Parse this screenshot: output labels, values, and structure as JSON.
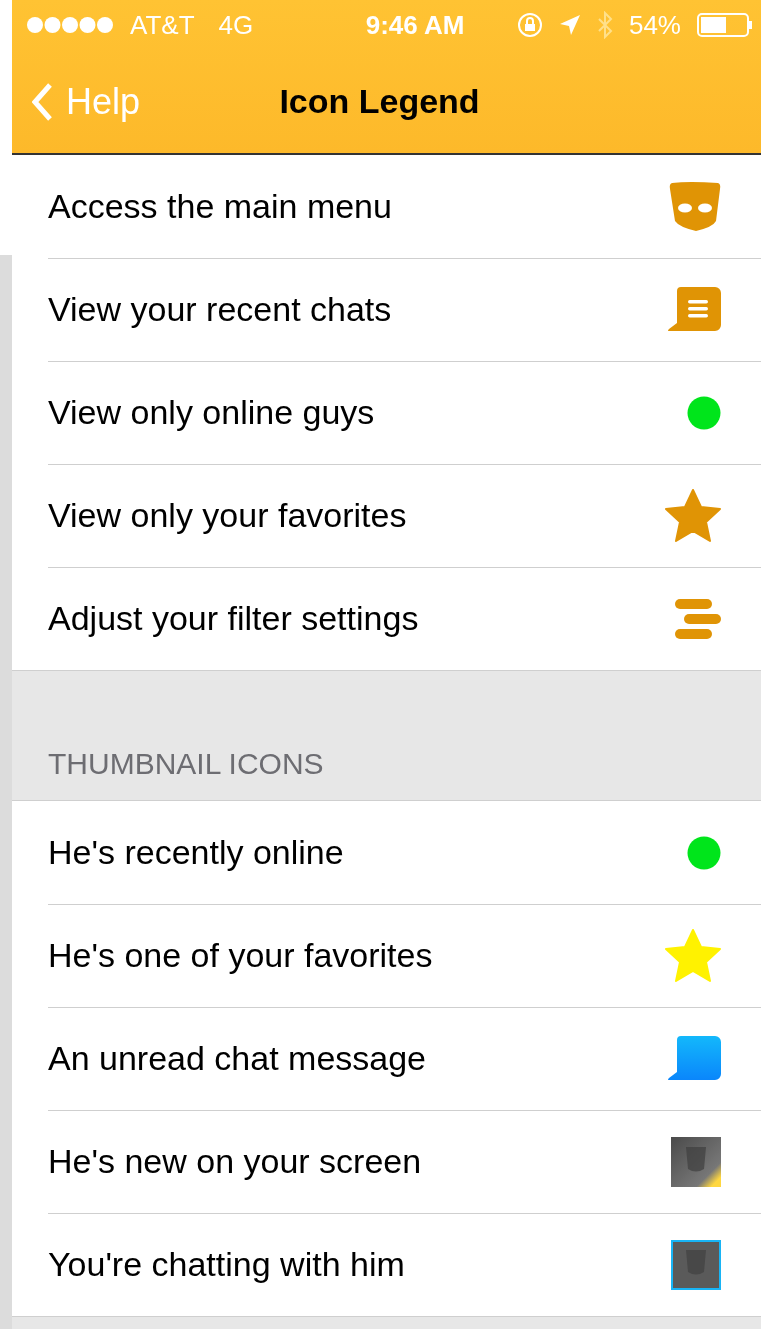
{
  "status_bar": {
    "carrier": "AT&T",
    "network": "4G",
    "time": "9:46 AM",
    "battery_percent": "54%"
  },
  "nav_bar": {
    "back_label": "Help",
    "title": "Icon Legend"
  },
  "sections": [
    {
      "items": [
        {
          "label": "Access the main menu",
          "kind": "mask"
        },
        {
          "label": "View your recent chats",
          "kind": "chat"
        },
        {
          "label": "View only online guys",
          "kind": "dot",
          "color": "#00e51b"
        },
        {
          "label": "View only your favorites",
          "kind": "star",
          "color": "#e09405"
        },
        {
          "label": "Adjust your filter settings",
          "kind": "filter"
        }
      ]
    },
    {
      "header": "THUMBNAIL ICONS",
      "items": [
        {
          "label": "He's recently online",
          "kind": "dot",
          "color": "#00e51b"
        },
        {
          "label": "He's one of your favorites",
          "kind": "star",
          "color": "#fff200"
        },
        {
          "label": "An unread chat message",
          "kind": "bubble"
        },
        {
          "label": "He's new on your screen",
          "kind": "thumb-new"
        },
        {
          "label": "You're chatting with him",
          "kind": "thumb-chatting"
        }
      ]
    }
  ]
}
